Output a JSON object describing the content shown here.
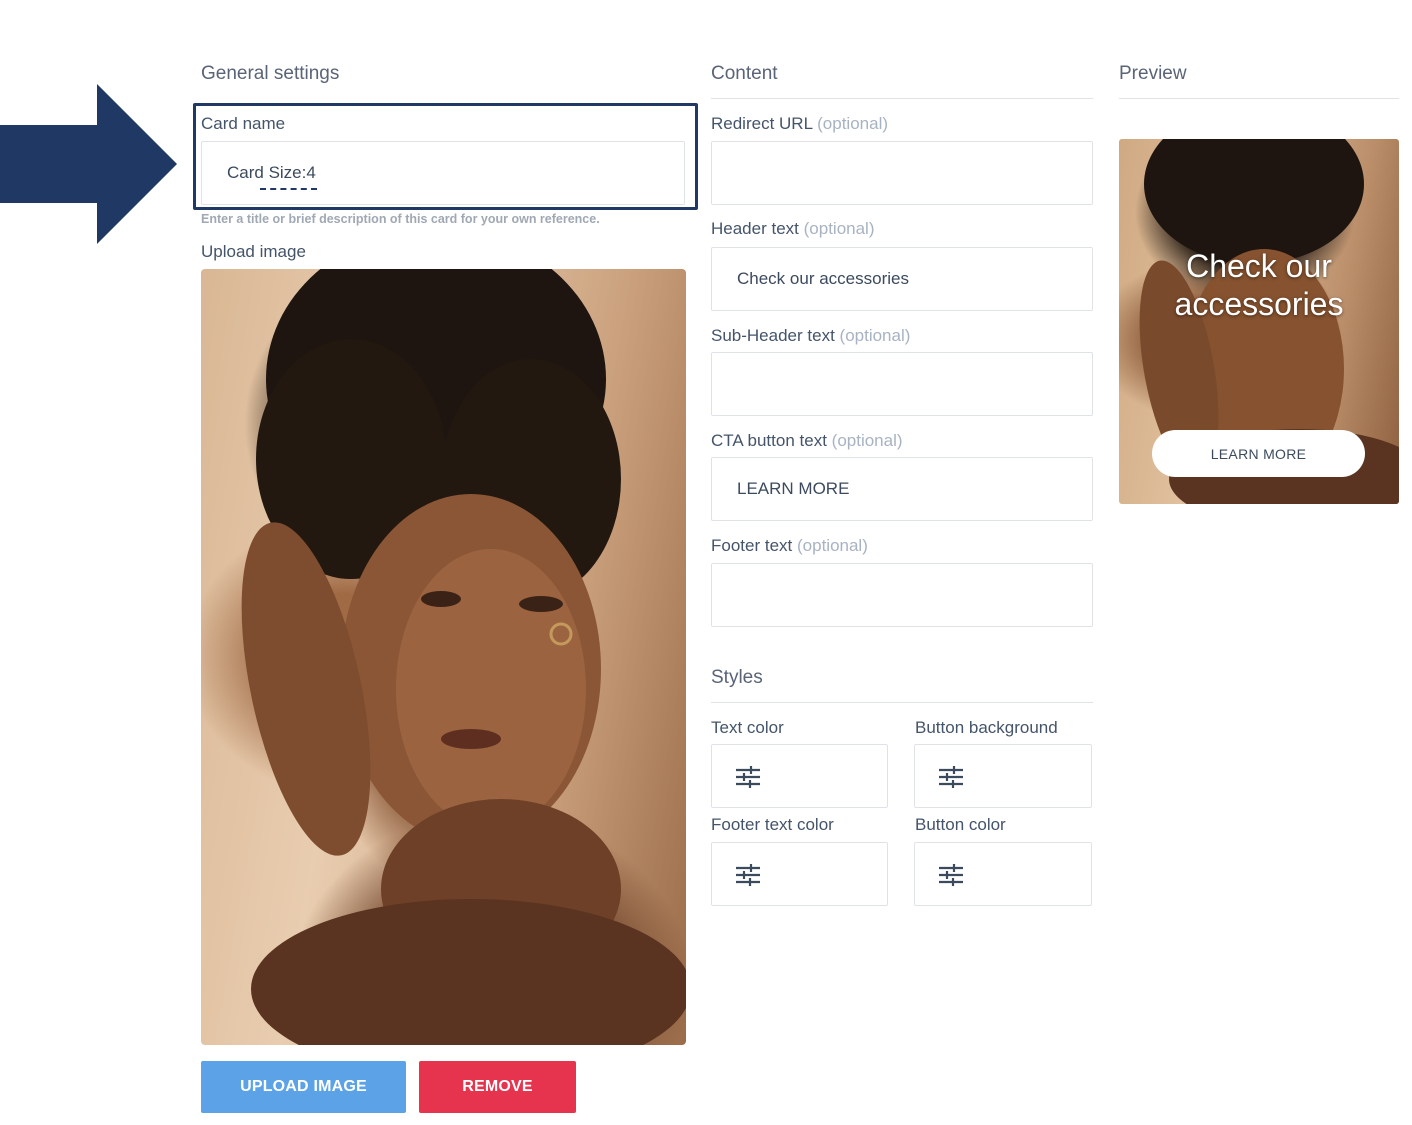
{
  "sections": {
    "general": "General settings",
    "content": "Content",
    "preview": "Preview",
    "styles": "Styles"
  },
  "card_name": {
    "label": "Card name",
    "value": "Card Size:4",
    "hint": "Enter a title or brief description of this card for your own reference."
  },
  "upload": {
    "label": "Upload image",
    "upload_button": "UPLOAD IMAGE",
    "remove_button": "REMOVE"
  },
  "content": {
    "redirect_url": {
      "label": "Redirect URL",
      "optional": "(optional)",
      "value": ""
    },
    "header_text": {
      "label": "Header text",
      "optional": "(optional)",
      "value": "Check our accessories"
    },
    "subheader_text": {
      "label": "Sub-Header text",
      "optional": "(optional)",
      "value": ""
    },
    "cta_text": {
      "label": "CTA button text",
      "optional": "(optional)",
      "value": "LEARN MORE"
    },
    "footer_text": {
      "label": "Footer text",
      "optional": "(optional)",
      "value": ""
    }
  },
  "styles": {
    "text_color": "Text color",
    "button_background": "Button background",
    "footer_text_color": "Footer text color",
    "button_color": "Button color",
    "swatch_icon": "sliders-icon"
  },
  "preview": {
    "header": "Check our accessories",
    "cta": "LEARN MORE"
  },
  "colors": {
    "highlight_frame": "#1f3864",
    "arrow": "#1f3864",
    "upload_button": "#5ba3e6",
    "remove_button": "#e6344f"
  }
}
